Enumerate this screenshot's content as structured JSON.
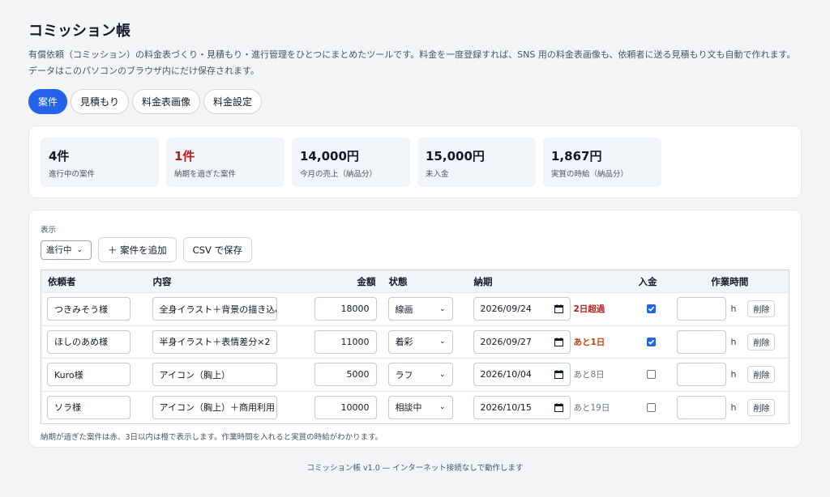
{
  "app": {
    "title": "コミッション帳",
    "description": "有償依頼（コミッション）の料金表づくり・見積もり・進行管理をひとつにまとめたツールです。料金を一度登録すれば、SNS 用の料金表画像も、依頼者に送る見積もり文も自動で作れます。データはこのパソコンのブラウザ内にだけ保存されます。"
  },
  "tabs": [
    "案件",
    "見積もり",
    "料金表画像",
    "料金設定"
  ],
  "stats": [
    {
      "value": "4件",
      "label": "進行中の案件"
    },
    {
      "value": "1件",
      "label": "納期を過ぎた案件"
    },
    {
      "value": "14,000円",
      "label": "今月の売上（納品分）"
    },
    {
      "value": "15,000円",
      "label": "未入金"
    },
    {
      "value": "1,867円",
      "label": "実質の時給（納品分）"
    }
  ],
  "filter": {
    "label": "表示",
    "value": "進行中"
  },
  "buttons": {
    "add": "＋ 案件を追加",
    "csv": "CSV で保存",
    "delete": "削除"
  },
  "table": {
    "headers": {
      "client": "依頼者",
      "content": "内容",
      "amount": "金額",
      "status": "状態",
      "due": "納期",
      "paid": "入金",
      "hours": "作業時間"
    },
    "unit_hours": "h",
    "rows": [
      {
        "client": "つきみそう様",
        "content": "全身イラスト＋背景の描き込み",
        "amount": "18000",
        "status": "線画",
        "due": "2026/09/24",
        "due_note": "2日超過",
        "paid": true
      },
      {
        "client": "ほしのあめ様",
        "content": "半身イラスト＋表情差分×2",
        "amount": "11000",
        "status": "着彩",
        "due": "2026/09/27",
        "due_note": "あと1日",
        "paid": true
      },
      {
        "client": "Kuro様",
        "content": "アイコン（胸上）",
        "amount": "5000",
        "status": "ラフ",
        "due": "2026/10/04",
        "due_note": "あと8日",
        "paid": false
      },
      {
        "client": "ソラ様",
        "content": "アイコン（胸上）＋商用利用",
        "amount": "10000",
        "status": "相談中",
        "due": "2026/10/15",
        "due_note": "あと19日",
        "paid": false
      }
    ]
  },
  "note": "納期が過ぎた案件は赤、3日以内は橙で表示します。作業時間を入れると実質の時給がわかります。",
  "footer": "コミッション帳 v1.0 — インターネット接続なしで動作します",
  "colors": {
    "accent": "#2563eb",
    "overdue": "#b91c1c",
    "soon": "#c2410c"
  }
}
